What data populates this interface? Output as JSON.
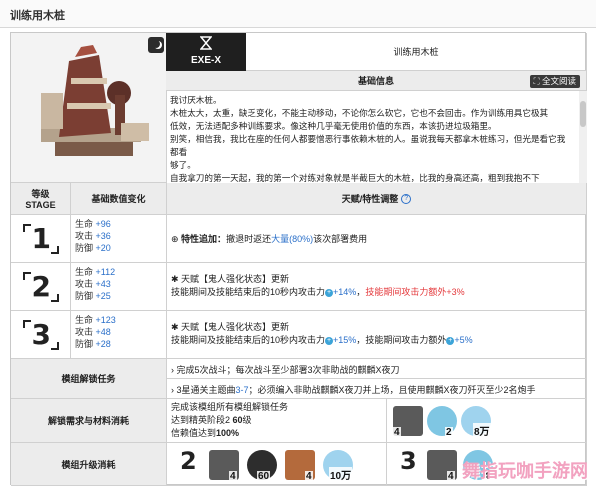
{
  "page": {
    "title": "训练用木桩"
  },
  "operator": {
    "exe_label": "EXE-X",
    "name": "训练用木桩",
    "basic_info_header": "基础信息",
    "fullscreen_button": "全文阅读",
    "description_lines": [
      "我讨厌木桩。",
      "木桩太大，太重，缺乏变化，不能主动移动，不论你怎么砍它，它也不会回击。作为训练用具它极其",
      "低效，无法适配多种训练要求。像这种几乎毫无使用价值的东西，本该扔进垃圾箱里。",
      "别笑，相信我，我比在座的任何人都要憎恶行事依赖木桩的人。虽说我每天都拿木桩练习，但光是看它我都看",
      "够了。",
      "自我拿刀的第一天起，我的第一个对练对象就是半截巨大的木桩，比我的身高还高，粗到我抱不下"
    ]
  },
  "headers": {
    "stage": "等级",
    "stage_en": "STAGE",
    "stat_change": "基础数值变化",
    "talent": "天赋/特性调整"
  },
  "stages": [
    {
      "num": "1",
      "hp_label": "生命",
      "hp": "+96",
      "atk_label": "攻击",
      "atk": "+36",
      "def_label": "防御",
      "def": "+20",
      "talent_prefix": "特性追加：",
      "talent_text_a": "撤退时返还",
      "talent_highlight": "大量(80%)",
      "talent_text_b": "该次部署费用"
    },
    {
      "num": "2",
      "hp_label": "生命",
      "hp": "+112",
      "atk_label": "攻击",
      "atk": "+43",
      "def_label": "防御",
      "def": "+25",
      "talent_title": "天赋【鬼人强化状态】更新",
      "talent_line": "技能期间及技能结束后的10秒内攻击力",
      "talent_val": "+14%",
      "talent_red": "技能期间攻击力额外+3%"
    },
    {
      "num": "3",
      "hp_label": "生命",
      "hp": "+123",
      "atk_label": "攻击",
      "atk": "+48",
      "def_label": "防御",
      "def": "+28",
      "talent_title": "天赋【鬼人强化状态】更新",
      "talent_line": "技能期间及技能结束后的10秒内攻击力",
      "talent_val": "+15%",
      "talent_tail": "技能期间攻击力额外",
      "talent_val2": "+5%"
    }
  ],
  "unlock": {
    "label": "模组解锁任务",
    "task1": "完成5次战斗；每次战斗至少部署3次非助战的麒麟X夜刀",
    "task2_a": "3星通关主题曲",
    "task2_stage": "3-7",
    "task2_b": "；必须编入非助战麒麟X夜刀并上场，且使用麒麟X夜刀歼灭至少2名炮手"
  },
  "requirements": {
    "label": "解锁需求与材料消耗",
    "line1": "完成该模组所有模组解锁任务",
    "line2_a": "达到精英阶段2 ",
    "line2_b": "60",
    "line2_c": "级",
    "line3_a": "信赖值达到",
    "line3_b": "100%",
    "materials": [
      "4",
      "2",
      "8万"
    ]
  },
  "upgrade": {
    "label": "模组升级消耗",
    "stage2_materials": [
      "4",
      "60",
      "4",
      "10万"
    ],
    "stage3_materials": [
      "4",
      "4"
    ]
  },
  "watermark": "舞指玩咖手游网"
}
